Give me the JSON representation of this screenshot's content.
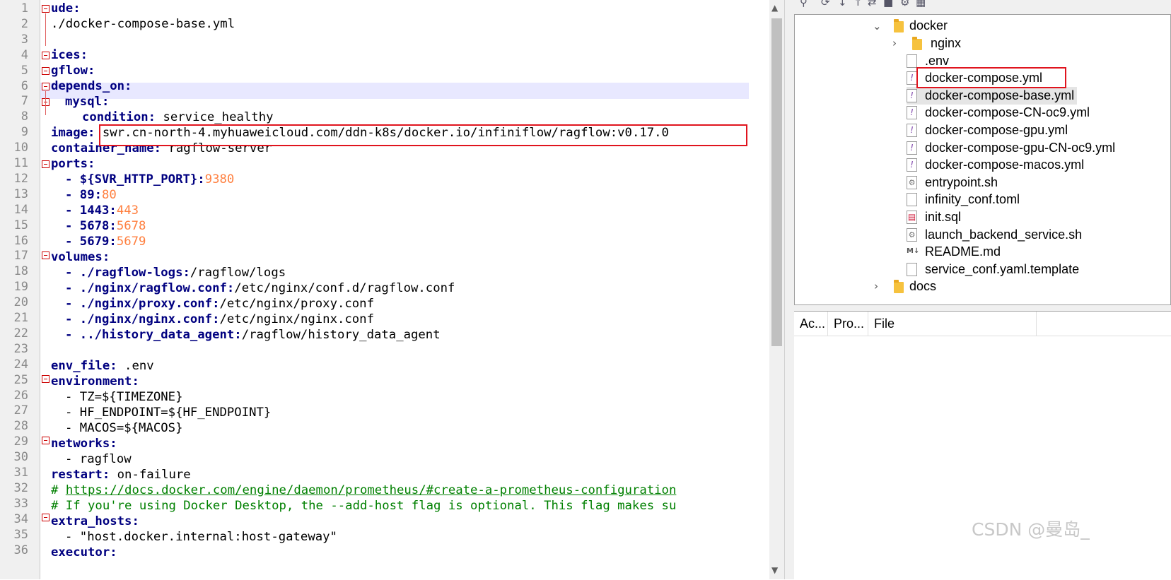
{
  "editor": {
    "line_numbers": [
      "1",
      "2",
      "3",
      "4",
      "5",
      "6",
      "7",
      "8",
      "9",
      "10",
      "11",
      "12",
      "13",
      "14",
      "15",
      "16",
      "17",
      "18",
      "19",
      "20",
      "21",
      "22",
      "23",
      "24",
      "25",
      "26",
      "27",
      "28",
      "29",
      "30",
      "31",
      "32",
      "33",
      "34",
      "35",
      "36"
    ],
    "lines": {
      "l1_key": "ude:",
      "l2_text": "./docker-compose-base.yml",
      "l4_key": "ices:",
      "l5_key": "gflow:",
      "l6_key": "depends_on:",
      "l7_key": "mysql:",
      "l8_key": "condition:",
      "l8_val": " service_healthy",
      "l9_key": "image:",
      "l9_val": "swr.cn-north-4.myhuaweicloud.com/ddn-k8s/docker.io/infiniflow/ragflow:v0.17.0",
      "l10_key": "container_name:",
      "l10_val": " ragflow-server",
      "l11_key": "ports:",
      "l12_key": "- ${SVR_HTTP_PORT}:",
      "l12_num": "9380",
      "l13_key": "- 89:",
      "l13_num": "80",
      "l14_key": "- 1443:",
      "l14_num": "443",
      "l15_key": "- 5678:",
      "l15_num": "5678",
      "l16_key": "- 5679:",
      "l16_num": "5679",
      "l17_key": "volumes:",
      "l18_key": "- ./ragflow-logs:",
      "l18_val": "/ragflow/logs",
      "l19_key": "- ./nginx/ragflow.conf:",
      "l19_val": "/etc/nginx/conf.d/ragflow.conf",
      "l20_key": "- ./nginx/proxy.conf:",
      "l20_val": "/etc/nginx/proxy.conf",
      "l21_key": "- ./nginx/nginx.conf:",
      "l21_val": "/etc/nginx/nginx.conf",
      "l22_key": "- ../history_data_agent:",
      "l22_val": "/ragflow/history_data_agent",
      "l24_key": "env_file:",
      "l24_val": " .env",
      "l25_key": "environment:",
      "l26_text": "- TZ=${TIMEZONE}",
      "l27_text": "- HF_ENDPOINT=${HF_ENDPOINT}",
      "l28_text": "- MACOS=${MACOS}",
      "l29_key": "networks:",
      "l30_text": "- ragflow",
      "l31_key": "restart:",
      "l31_val": " on-failure",
      "l32_hash": "# ",
      "l32_url": "https://docs.docker.com/engine/daemon/prometheus/#create-a-prometheus-configuration",
      "l33_text": "# If you're using Docker Desktop, the --add-host flag is optional. This flag makes su",
      "l34_key": "extra_hosts:",
      "l35_text": "- \"host.docker.internal:host-gateway\"",
      "l36_key": "executor:"
    }
  },
  "tree": {
    "docker_folder": "docker",
    "items": [
      {
        "label": "nginx",
        "kind": "folder"
      },
      {
        "label": ".env",
        "kind": "file"
      },
      {
        "label": "docker-compose.yml",
        "kind": "yml"
      },
      {
        "label": "docker-compose-base.yml",
        "kind": "yml"
      },
      {
        "label": "docker-compose-CN-oc9.yml",
        "kind": "yml"
      },
      {
        "label": "docker-compose-gpu.yml",
        "kind": "yml"
      },
      {
        "label": "docker-compose-gpu-CN-oc9.yml",
        "kind": "yml"
      },
      {
        "label": "docker-compose-macos.yml",
        "kind": "yml"
      },
      {
        "label": "entrypoint.sh",
        "kind": "sh"
      },
      {
        "label": "infinity_conf.toml",
        "kind": "file"
      },
      {
        "label": "init.sql",
        "kind": "sql"
      },
      {
        "label": "launch_backend_service.sh",
        "kind": "sh"
      },
      {
        "label": "README.md",
        "kind": "md"
      },
      {
        "label": "service_conf.yaml.template",
        "kind": "file"
      }
    ],
    "docs_folder": "docs",
    "selected": "docker-compose-base.yml"
  },
  "columns": [
    "Ac...",
    "Pro...",
    "File"
  ],
  "watermark": "CSDN @曼岛_",
  "colors": {
    "keyword": "#000080",
    "number": "#ff8040",
    "comment": "#008000",
    "highlight_box": "#e0141e"
  }
}
